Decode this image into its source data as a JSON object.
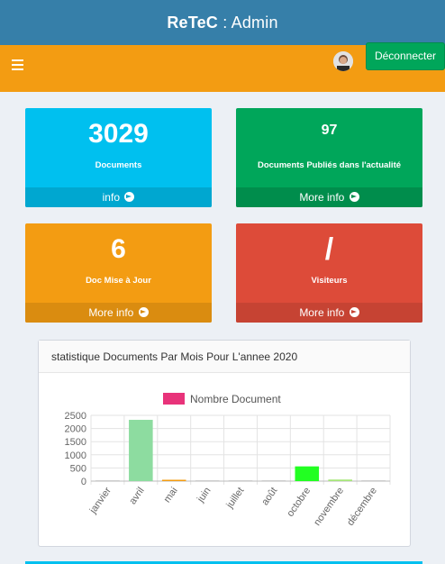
{
  "header": {
    "brand": "ReTeC",
    "sep": " : ",
    "role": "Admin"
  },
  "nav": {
    "menu_icon": "hamburger-icon",
    "logout_label": "Déconnecter"
  },
  "boxes": [
    {
      "value": "3029",
      "label": "Documents",
      "link": "info",
      "color": "#00c0ef"
    },
    {
      "value": "97",
      "label": "Documents Publiés dans l'actualité",
      "link": "More info",
      "color": "#00a65a"
    },
    {
      "value": "6",
      "label": "Doc Mise à Jour",
      "link": "More info",
      "color": "#f39c12"
    },
    {
      "value": "/",
      "label": "Visiteurs",
      "link": "More info",
      "color": "#dd4b39"
    }
  ],
  "panel": {
    "title": "statistique Documents Par Mois Pour L'annee 2020"
  },
  "chart_data": {
    "type": "bar",
    "legend": "Nombre Document",
    "legend_color": "#e8337a",
    "categories": [
      "janvier",
      "avril",
      "mai",
      "juin",
      "juillet",
      "août",
      "octobre",
      "novembre",
      "décembre"
    ],
    "values": [
      0,
      2330,
      30,
      0,
      0,
      0,
      560,
      60,
      0
    ],
    "colors": [
      "#cccccc",
      "#8ddca0",
      "#f39c12",
      "#cccccc",
      "#cccccc",
      "#cccccc",
      "#22ff22",
      "#a6e57a",
      "#cccccc"
    ],
    "yticks": [
      0,
      500,
      1000,
      1500,
      2000,
      2500
    ],
    "ylim": [
      0,
      2500
    ],
    "grid": true,
    "legend_position": "top"
  }
}
